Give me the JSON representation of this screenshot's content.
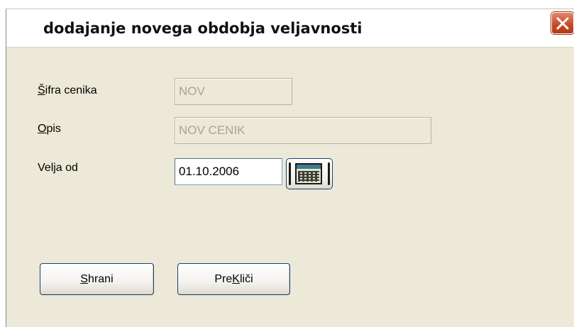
{
  "window": {
    "title": "dodajanje novega obdobja veljavnosti"
  },
  "form": {
    "sifra": {
      "label_accel": "Š",
      "label_rest": "ifra cenika",
      "value": "NOV"
    },
    "opis": {
      "label_accel": "O",
      "label_rest": "pis",
      "value": "NOV CENIK"
    },
    "velja": {
      "label": "Velja od",
      "value": "01.10.2006"
    }
  },
  "buttons": {
    "save": {
      "accel": "S",
      "rest": "hrani"
    },
    "cancel": {
      "pre": "Pre",
      "accel": "K",
      "rest": "liči"
    }
  },
  "icons": {
    "close": "close-icon",
    "calendar": "calendar-icon"
  },
  "colors": {
    "dialog_bg": "#ece9d8",
    "close_button": "#c44a25",
    "button_border": "#1e3f75"
  }
}
